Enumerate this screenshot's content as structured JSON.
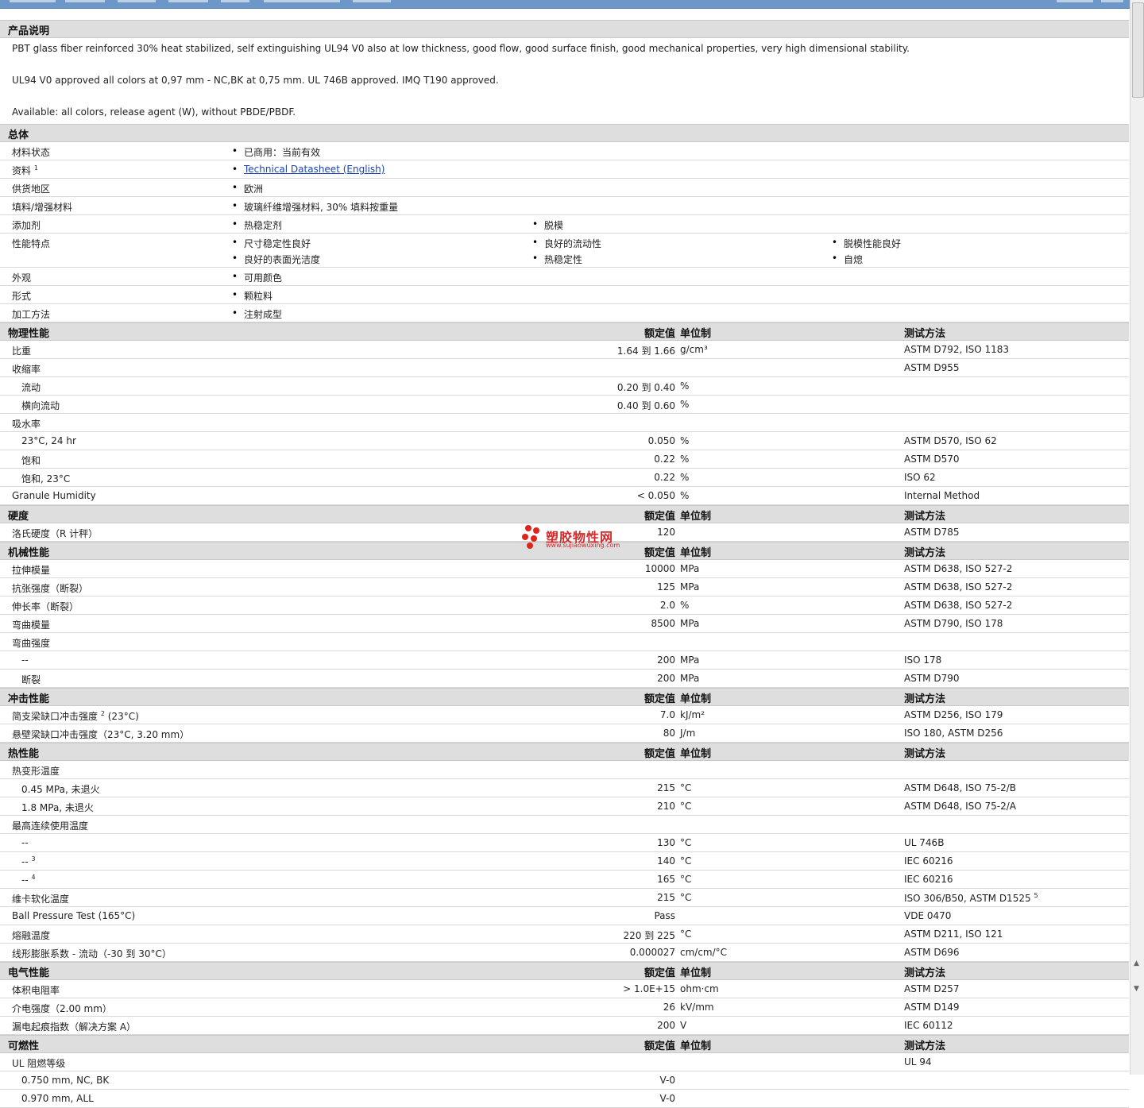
{
  "colors": {
    "topbar": "#6d97c8",
    "section_bg": "#dedede",
    "link": "#1a44b8",
    "watermark": "#e2231a"
  },
  "header": {
    "title": "产品说明"
  },
  "description": {
    "para1": "PBT glass fiber reinforced 30% heat stabilized, self extinguishing UL94 V0 also at low thickness, good flow, good surface finish, good mechanical properties, very high dimensional stability.",
    "para2": "UL94 V0 approved all colors at 0,97 mm - NC,BK at 0,75 mm. UL 746B approved. IMQ T190 approved.",
    "para3": "Available: all colors, release agent (W), without PBDE/PBDF."
  },
  "general": {
    "title": "总体",
    "rows": [
      {
        "label": "材料状态",
        "items": [
          "已商用：当前有效"
        ]
      },
      {
        "label": "资料",
        "sup": "1",
        "link": "Technical Datasheet (English)"
      },
      {
        "label": "供货地区",
        "items": [
          "欧洲"
        ]
      },
      {
        "label": "填料/增强材料",
        "items": [
          "玻璃纤维增强材料, 30% 填料按重量"
        ]
      },
      {
        "label": "添加剂",
        "items": [
          "热稳定剂",
          "脱模"
        ]
      },
      {
        "label": "性能特点",
        "items": [
          "尺寸稳定性良好",
          "良好的流动性",
          "脱模性能良好",
          "良好的表面光洁度",
          "热稳定性",
          "自熄"
        ]
      },
      {
        "label": "外观",
        "items": [
          "可用颜色"
        ]
      },
      {
        "label": "形式",
        "items": [
          "颗粒料"
        ]
      },
      {
        "label": "加工方法",
        "items": [
          "注射成型"
        ]
      }
    ]
  },
  "headers": {
    "nominal": "额定值",
    "unit": "单位制",
    "method": "测试方法"
  },
  "physical": {
    "title": "物理性能",
    "rows": [
      {
        "label": "比重",
        "value": "1.64 到  1.66",
        "unit": "g/cm³",
        "method": "ASTM D792, ISO 1183"
      },
      {
        "label": "收缩率",
        "value": "",
        "unit": "",
        "method": "ASTM D955"
      },
      {
        "label": "流动",
        "value": "0.20 到  0.40",
        "unit": "%",
        "method": ""
      },
      {
        "label": "横向流动",
        "value": "0.40 到  0.60",
        "unit": "%",
        "method": ""
      },
      {
        "label": "吸水率",
        "value": "",
        "unit": "",
        "method": ""
      },
      {
        "label": "23°C, 24 hr",
        "value": "0.050",
        "unit": "%",
        "method": "ASTM D570, ISO 62"
      },
      {
        "label": "饱和",
        "value": "0.22",
        "unit": "%",
        "method": "ASTM D570"
      },
      {
        "label": "饱和, 23°C",
        "value": "0.22",
        "unit": "%",
        "method": "ISO 62"
      },
      {
        "label": "Granule Humidity",
        "value": "< 0.050",
        "unit": "%",
        "method": "Internal Method"
      }
    ]
  },
  "hardness": {
    "title": "硬度",
    "rows": [
      {
        "label": "洛氏硬度（R 计秤）",
        "value": "120",
        "unit": "",
        "method": "ASTM D785"
      }
    ]
  },
  "mechanical": {
    "title": "机械性能",
    "rows": [
      {
        "label": "拉伸模量",
        "value": "10000",
        "unit": "MPa",
        "method": "ASTM D638, ISO 527-2"
      },
      {
        "label": "抗张强度（断裂）",
        "value": "125",
        "unit": "MPa",
        "method": "ASTM D638, ISO 527-2"
      },
      {
        "label": "伸长率（断裂）",
        "value": "2.0",
        "unit": "%",
        "method": "ASTM D638, ISO 527-2"
      },
      {
        "label": "弯曲模量",
        "value": "8500",
        "unit": "MPa",
        "method": "ASTM D790, ISO 178"
      },
      {
        "label": "弯曲强度",
        "value": "",
        "unit": "",
        "method": ""
      },
      {
        "label": "--",
        "value": "200",
        "unit": "MPa",
        "method": "ISO 178"
      },
      {
        "label": "断裂",
        "value": "200",
        "unit": "MPa",
        "method": "ASTM D790"
      }
    ]
  },
  "impact": {
    "title": "冲击性能",
    "rows": [
      {
        "label": "简支梁缺口冲击强度",
        "sup": "2",
        "suffix": " (23°C)",
        "value": "7.0",
        "unit": "kJ/m²",
        "method": "ASTM D256, ISO 179"
      },
      {
        "label": "悬壁梁缺口冲击强度（23°C, 3.20 mm）",
        "value": "80",
        "unit": "J/m",
        "method": "ISO 180, ASTM D256"
      }
    ]
  },
  "thermal": {
    "title": "热性能",
    "rows": [
      {
        "label": "热变形温度",
        "value": "",
        "unit": "",
        "method": ""
      },
      {
        "label": "0.45 MPa, 未退火",
        "value": "215",
        "unit": "°C",
        "method": "ASTM D648, ISO 75-2/B"
      },
      {
        "label": "1.8 MPa, 未退火",
        "value": "210",
        "unit": "°C",
        "method": "ASTM D648, ISO 75-2/A"
      },
      {
        "label": "最高连续使用温度",
        "value": "",
        "unit": "",
        "method": ""
      },
      {
        "label": "--",
        "value": "130",
        "unit": "°C",
        "method": "UL 746B"
      },
      {
        "label": "--",
        "sup": "3",
        "value": "140",
        "unit": "°C",
        "method": "IEC 60216"
      },
      {
        "label": "--",
        "sup": "4",
        "value": "165",
        "unit": "°C",
        "method": "IEC 60216"
      },
      {
        "label": "维卡软化温度",
        "value": "215",
        "unit": "°C",
        "method": "ISO 306/B50, ASTM D1525",
        "method_sup": "5"
      },
      {
        "label": "Ball Pressure Test (165°C)",
        "value": "Pass",
        "unit": "",
        "method": "VDE 0470"
      },
      {
        "label": "熔融温度",
        "value": "220 到  225",
        "unit": "°C",
        "method": "ASTM D211, ISO 121"
      },
      {
        "label": "线形膨胀系数 - 流动（-30 到  30°C）",
        "value": "0.000027",
        "unit": "cm/cm/°C",
        "method": "ASTM D696"
      }
    ]
  },
  "electrical": {
    "title": "电气性能",
    "rows": [
      {
        "label": "体积电阻率",
        "value": "> 1.0E+15",
        "unit": "ohm·cm",
        "method": "ASTM D257"
      },
      {
        "label": "介电强度（2.00 mm）",
        "value": "26",
        "unit": "kV/mm",
        "method": "ASTM D149"
      },
      {
        "label": "漏电起痕指数（解决方案  A）",
        "value": "200",
        "unit": "V",
        "method": "IEC 60112"
      }
    ]
  },
  "flammability": {
    "title": "可燃性",
    "rows": [
      {
        "label": "UL 阻燃等级",
        "value": "",
        "unit": "",
        "method": "UL 94"
      },
      {
        "label": "0.750 mm, NC, BK",
        "value": "V-0",
        "unit": "",
        "method": ""
      },
      {
        "label": "0.970 mm, ALL",
        "value": "V-0",
        "unit": "",
        "method": ""
      }
    ]
  },
  "watermark": {
    "text": "塑胶物性网",
    "url": "www.sujiaowuxing.com"
  }
}
